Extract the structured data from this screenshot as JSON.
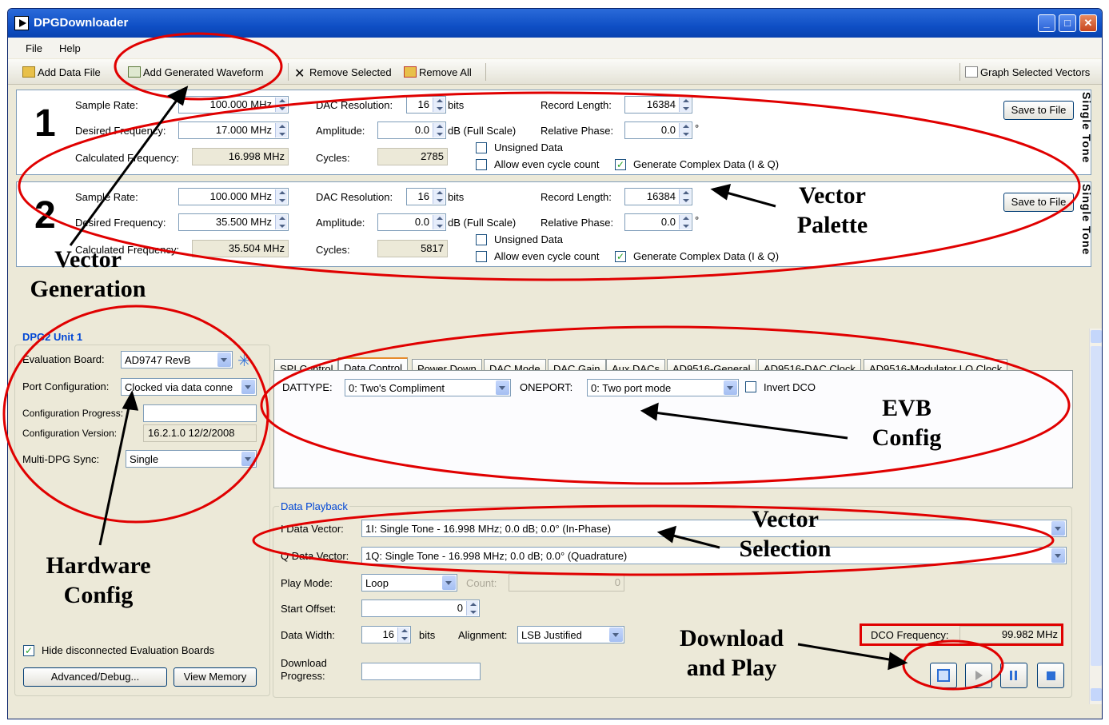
{
  "window": {
    "title": "DPGDownloader"
  },
  "menu": [
    "File",
    "Help"
  ],
  "toolbar": {
    "add_data_file": "Add Data File",
    "add_generated_waveform": "Add Generated Waveform",
    "remove_selected": "Remove Selected",
    "remove_all": "Remove All",
    "graph_selected_vectors": "Graph Selected Vectors"
  },
  "labels": {
    "sample_rate": "Sample Rate:",
    "desired_frequency": "Desired Frequency:",
    "calculated_frequency": "Calculated Frequency:",
    "dac_resolution": "DAC Resolution:",
    "amplitude": "Amplitude:",
    "cycles": "Cycles:",
    "record_length": "Record Length:",
    "relative_phase": "Relative Phase:",
    "bits": "bits",
    "db_full_scale": "dB (Full Scale)",
    "degree": "°",
    "unsigned_data": "Unsigned Data",
    "allow_even_cycle_count": "Allow even cycle count",
    "generate_complex": "Generate Complex Data (I & Q)",
    "save_to_file": "Save to File",
    "single_tone": "Single Tone"
  },
  "vectors": [
    {
      "number": "1",
      "sample_rate": "100.000 MHz",
      "desired_frequency": "17.000 MHz",
      "calculated_frequency": "16.998 MHz",
      "dac_resolution": "16",
      "amplitude": "0.0",
      "cycles": "2785",
      "record_length": "16384",
      "relative_phase": "0.0",
      "unsigned": false,
      "allow_even": false,
      "generate_complex": true
    },
    {
      "number": "2",
      "sample_rate": "100.000 MHz",
      "desired_frequency": "35.500 MHz",
      "calculated_frequency": "35.504 MHz",
      "dac_resolution": "16",
      "amplitude": "0.0",
      "cycles": "5817",
      "record_length": "16384",
      "relative_phase": "0.0",
      "unsigned": false,
      "allow_even": false,
      "generate_complex": true
    }
  ],
  "dpg": {
    "unit_title": "DPG2 Unit 1",
    "evaluation_board_label": "Evaluation Board:",
    "evaluation_board": "AD9747 RevB",
    "port_config_label": "Port Configuration:",
    "port_config": "Clocked via data conne",
    "config_progress_label": "Configuration Progress:",
    "config_version_label": "Configuration Version:",
    "config_version": "16.2.1.0 12/2/2008",
    "multi_dpg_label": "Multi-DPG Sync:",
    "multi_dpg": "Single",
    "hide_disconnected": "Hide disconnected Evaluation Boards",
    "advanced_debug": "Advanced/Debug...",
    "view_memory": "View Memory"
  },
  "tabs": [
    "SPI Control",
    "Data Control",
    "Power Down",
    "DAC Mode",
    "DAC Gain",
    "Aux DACs",
    "AD9516-General",
    "AD9516-DAC Clock",
    "AD9516-Modulator LO Clock"
  ],
  "data_control": {
    "dattype_label": "DATTYPE:",
    "dattype": "0: Two's Compliment",
    "oneport_label": "ONEPORT:",
    "oneport": "0: Two port mode",
    "invert_dco": "Invert DCO"
  },
  "playback": {
    "title": "Data Playback",
    "i_label": "I Data Vector:",
    "i_value": "1I: Single Tone - 16.998 MHz; 0.0 dB; 0.0° (In-Phase)",
    "q_label": "Q Data Vector:",
    "q_value": "1Q: Single Tone - 16.998 MHz; 0.0 dB; 0.0° (Quadrature)",
    "play_mode_label": "Play Mode:",
    "play_mode": "Loop",
    "count_label": "Count:",
    "count": "0",
    "start_offset_label": "Start Offset:",
    "start_offset": "0",
    "data_width_label": "Data Width:",
    "data_width": "16",
    "bits": "bits",
    "alignment_label": "Alignment:",
    "alignment": "LSB Justified",
    "download_progress_label": "Download Progress:",
    "dco_label": "DCO Frequency:",
    "dco_value": "99.982 MHz"
  },
  "annotations": {
    "vector_generation": "Vector Generation",
    "vector_palette": "Vector Palette",
    "hardware_config": "Hardware Config",
    "evb_config": "EVB Config",
    "vector_selection": "Vector Selection",
    "download_and_play": "Download and Play"
  }
}
